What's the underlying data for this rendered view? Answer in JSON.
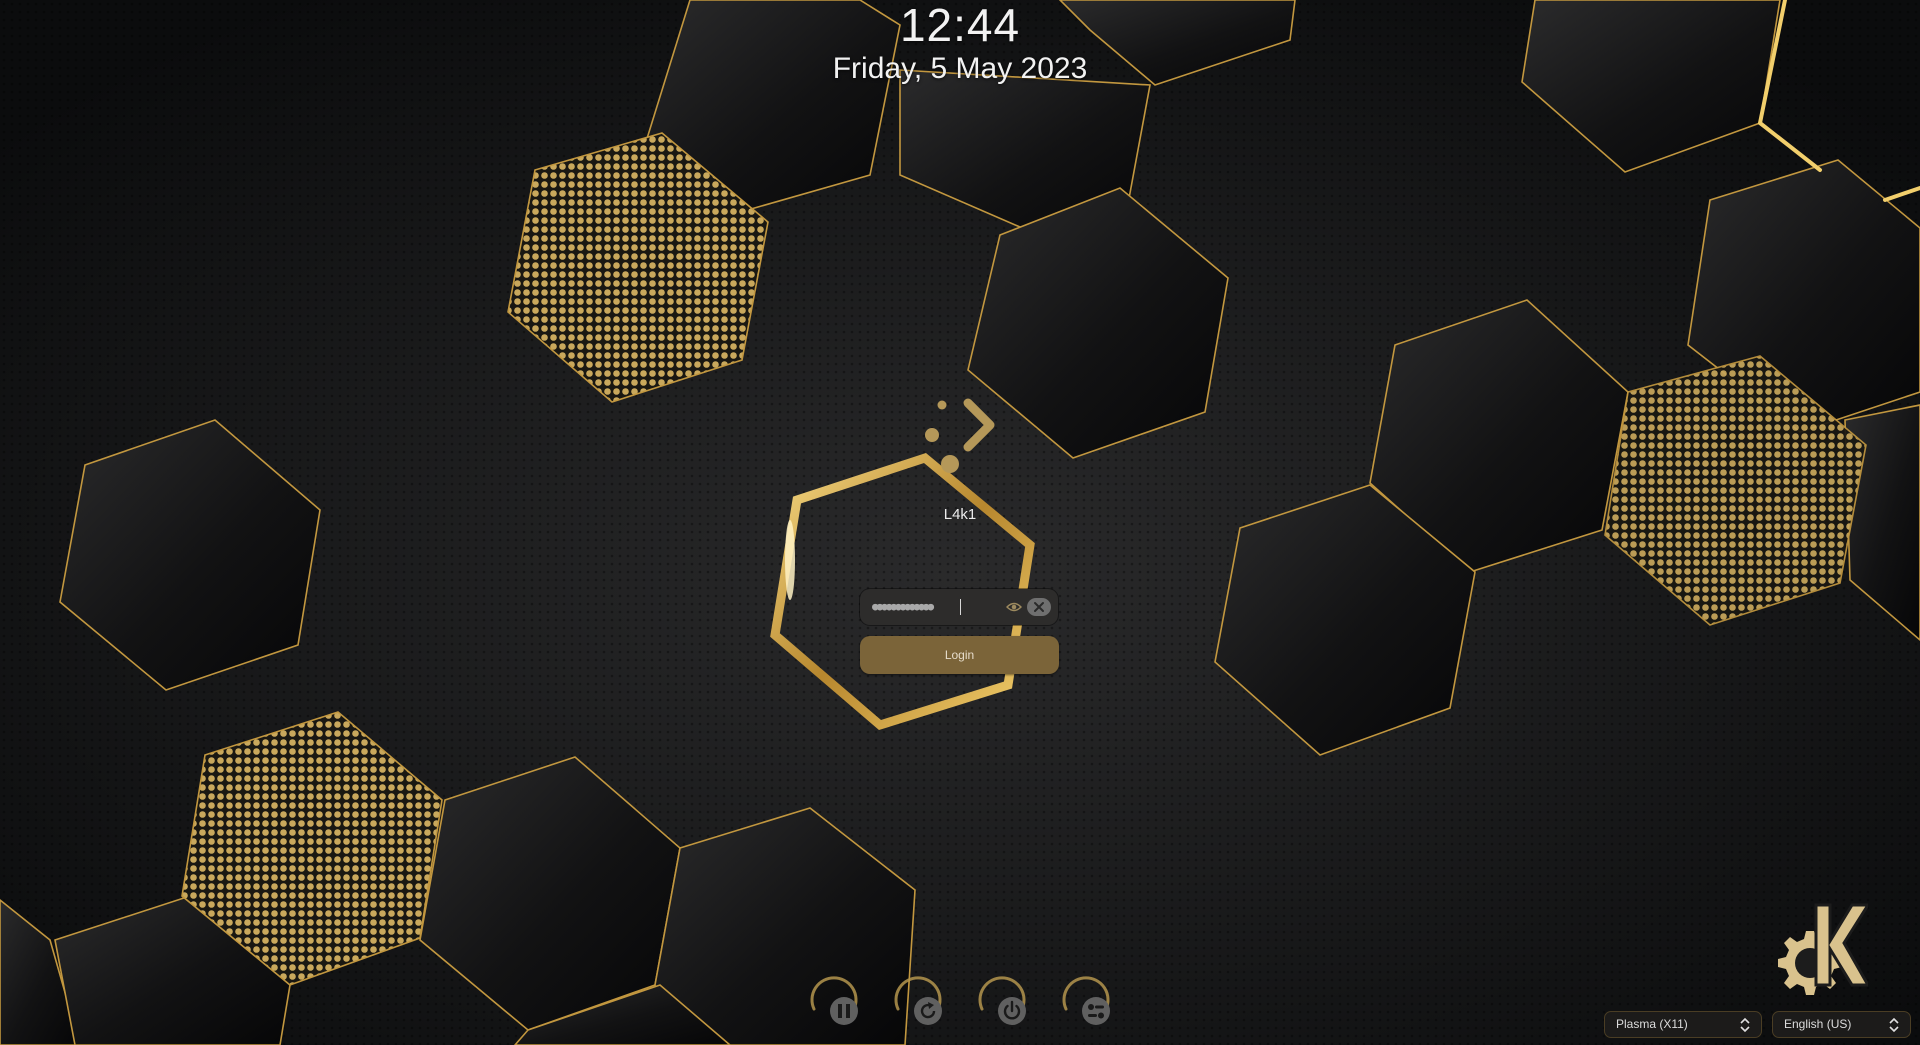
{
  "lockscreen": {
    "time": "12:44",
    "date": "Friday, 5 May 2023",
    "user_name": "L4k1",
    "password": {
      "masked_value": "●●●●●●●●●●●●●",
      "reveal_icon": "eye-icon",
      "clear_icon": "clear-icon"
    },
    "login_label": "Login",
    "actions": [
      {
        "name": "suspend",
        "icon": "pause-icon"
      },
      {
        "name": "restart",
        "icon": "restart-icon"
      },
      {
        "name": "shutdown",
        "icon": "power-icon"
      },
      {
        "name": "switch-user",
        "icon": "switch-user-icon"
      }
    ],
    "session": {
      "selected": "Plasma (X11)"
    },
    "keyboard_layout": {
      "selected": "English (US)"
    }
  },
  "colors": {
    "background": "#111214",
    "gold": "#d8b35a",
    "gold_bright": "#ffe9a8",
    "button": "#7b6439",
    "field": "#2d2c2b"
  }
}
